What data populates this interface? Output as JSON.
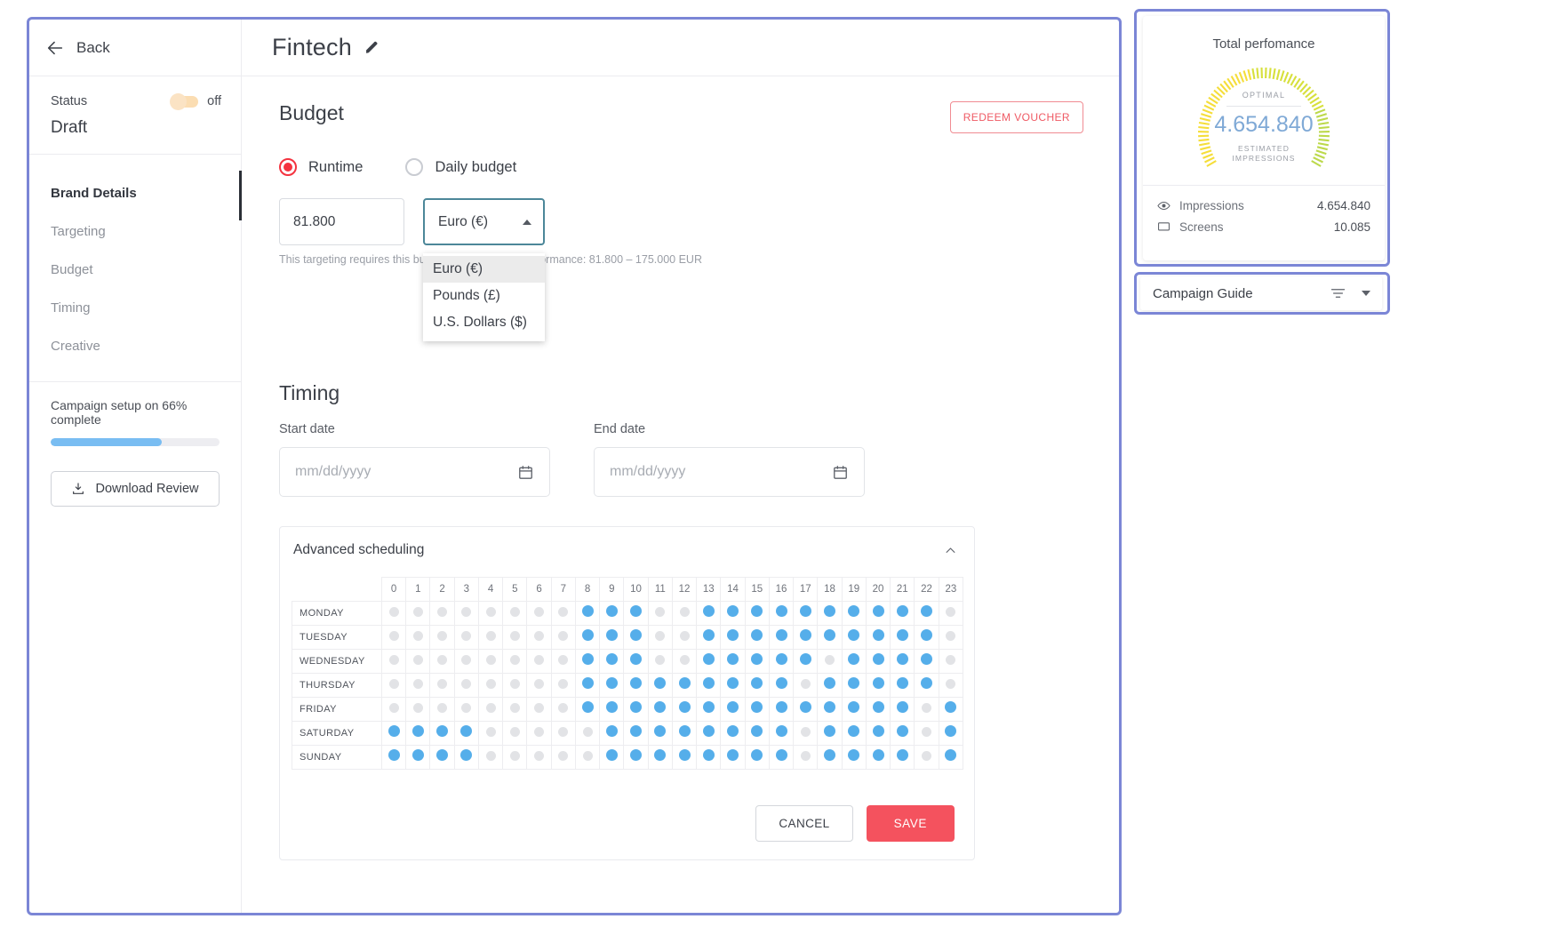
{
  "topbar": {
    "back_label": "Back",
    "campaign_title": "Fintech"
  },
  "sidebar": {
    "status_label": "Status",
    "toggle_state": "off",
    "status_value": "Draft",
    "nav_items": [
      {
        "label": "Brand Details",
        "active": true
      },
      {
        "label": "Targeting",
        "active": false
      },
      {
        "label": "Budget",
        "active": false
      },
      {
        "label": "Timing",
        "active": false
      },
      {
        "label": "Creative",
        "active": false
      }
    ],
    "progress_text": "Campaign setup on 66% complete",
    "progress_percent": 66,
    "download_label": "Download  Review"
  },
  "budget": {
    "section_title": "Budget",
    "voucher_button": "REDEEM VOUCHER",
    "options": [
      {
        "label": "Runtime",
        "checked": true
      },
      {
        "label": "Daily budget",
        "checked": false
      }
    ],
    "amount_value": "81.800",
    "currency_selected": "Euro (€)",
    "helper_text": "This targeting requires this budget for an optimal performance: 81.800 – 175.000 EUR",
    "currency_options": [
      {
        "label": "Euro (€)",
        "selected": true
      },
      {
        "label": "Pounds (£)",
        "selected": false
      },
      {
        "label": "U.S. Dollars ($)",
        "selected": false
      }
    ]
  },
  "timing": {
    "section_title": "Timing",
    "start_label": "Start date",
    "start_placeholder": "mm/dd/yyyy",
    "end_label": "End date",
    "end_placeholder": "mm/dd/yyyy"
  },
  "scheduling": {
    "title": "Advanced scheduling",
    "hours": [
      "0",
      "1",
      "2",
      "3",
      "4",
      "5",
      "6",
      "7",
      "8",
      "9",
      "10",
      "11",
      "12",
      "13",
      "14",
      "15",
      "16",
      "17",
      "18",
      "19",
      "20",
      "21",
      "22",
      "23"
    ],
    "days": [
      {
        "name": "MONDAY",
        "active_hours": [
          8,
          9,
          10,
          13,
          14,
          15,
          16,
          17,
          18,
          19,
          20,
          21,
          22
        ]
      },
      {
        "name": "TUESDAY",
        "active_hours": [
          8,
          9,
          10,
          13,
          14,
          15,
          16,
          17,
          18,
          19,
          20,
          21,
          22
        ]
      },
      {
        "name": "WEDNESDAY",
        "active_hours": [
          8,
          9,
          10,
          13,
          14,
          15,
          16,
          17,
          19,
          20,
          21,
          22
        ]
      },
      {
        "name": "THURSDAY",
        "active_hours": [
          8,
          9,
          10,
          11,
          12,
          13,
          14,
          15,
          16,
          18,
          19,
          20,
          21,
          22
        ]
      },
      {
        "name": "FRIDAY",
        "active_hours": [
          8,
          9,
          10,
          11,
          12,
          13,
          14,
          15,
          16,
          17,
          18,
          19,
          20,
          21,
          23
        ]
      },
      {
        "name": "SATURDAY",
        "active_hours": [
          0,
          1,
          2,
          3,
          9,
          10,
          11,
          12,
          13,
          14,
          15,
          16,
          18,
          19,
          20,
          21,
          23
        ]
      },
      {
        "name": "SUNDAY",
        "active_hours": [
          0,
          1,
          2,
          3,
          9,
          10,
          11,
          12,
          13,
          14,
          15,
          16,
          18,
          19,
          20,
          21,
          23
        ]
      }
    ],
    "cancel_label": "CANCEL",
    "save_label": "SAVE"
  },
  "performance": {
    "title": "Total perfomance",
    "gauge_caption": "OPTIMAL",
    "gauge_value": "4.654.840",
    "gauge_sub_line1": "ESTIMATED",
    "gauge_sub_line2": "IMPRESSIONS",
    "metrics": [
      {
        "icon": "eye-icon",
        "label": "Impressions",
        "value": "4.654.840"
      },
      {
        "icon": "screen-icon",
        "label": "Screens",
        "value": "10.085"
      }
    ]
  },
  "guide": {
    "title": "Campaign Guide"
  },
  "colors": {
    "accent_red": "#f4525e",
    "dot_active": "#55aeea",
    "progress": "#79bdf2",
    "select_border": "#4c8799",
    "gauge_value": "#7fa9d6"
  }
}
